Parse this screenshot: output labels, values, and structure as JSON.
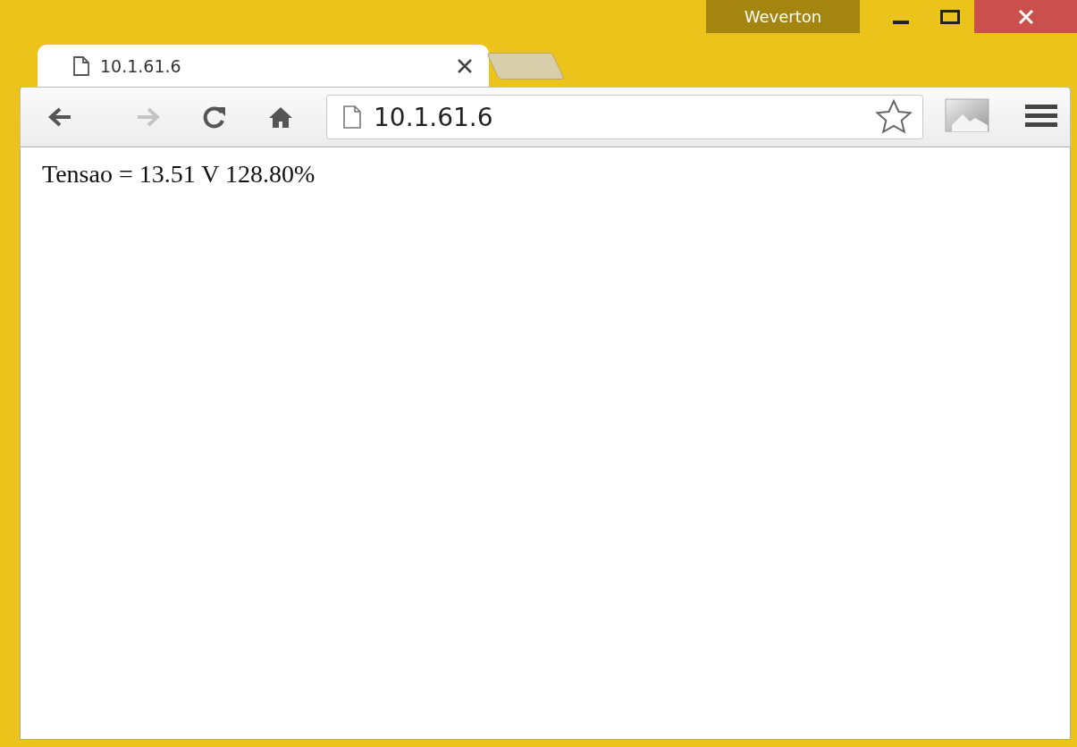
{
  "window": {
    "profile": "Weverton"
  },
  "tabs": [
    {
      "title": "10.1.61.6",
      "selected": true
    }
  ],
  "nav_buttons": [
    {
      "kind": "back",
      "disabled": false
    },
    {
      "kind": "forward",
      "disabled": true
    },
    {
      "kind": "reload",
      "disabled": false
    },
    {
      "kind": "home",
      "disabled": false
    }
  ],
  "address_bar": {
    "value": "10.1.61.6"
  },
  "page": {
    "text": "Tensao = 13.51 V 128.80%"
  }
}
